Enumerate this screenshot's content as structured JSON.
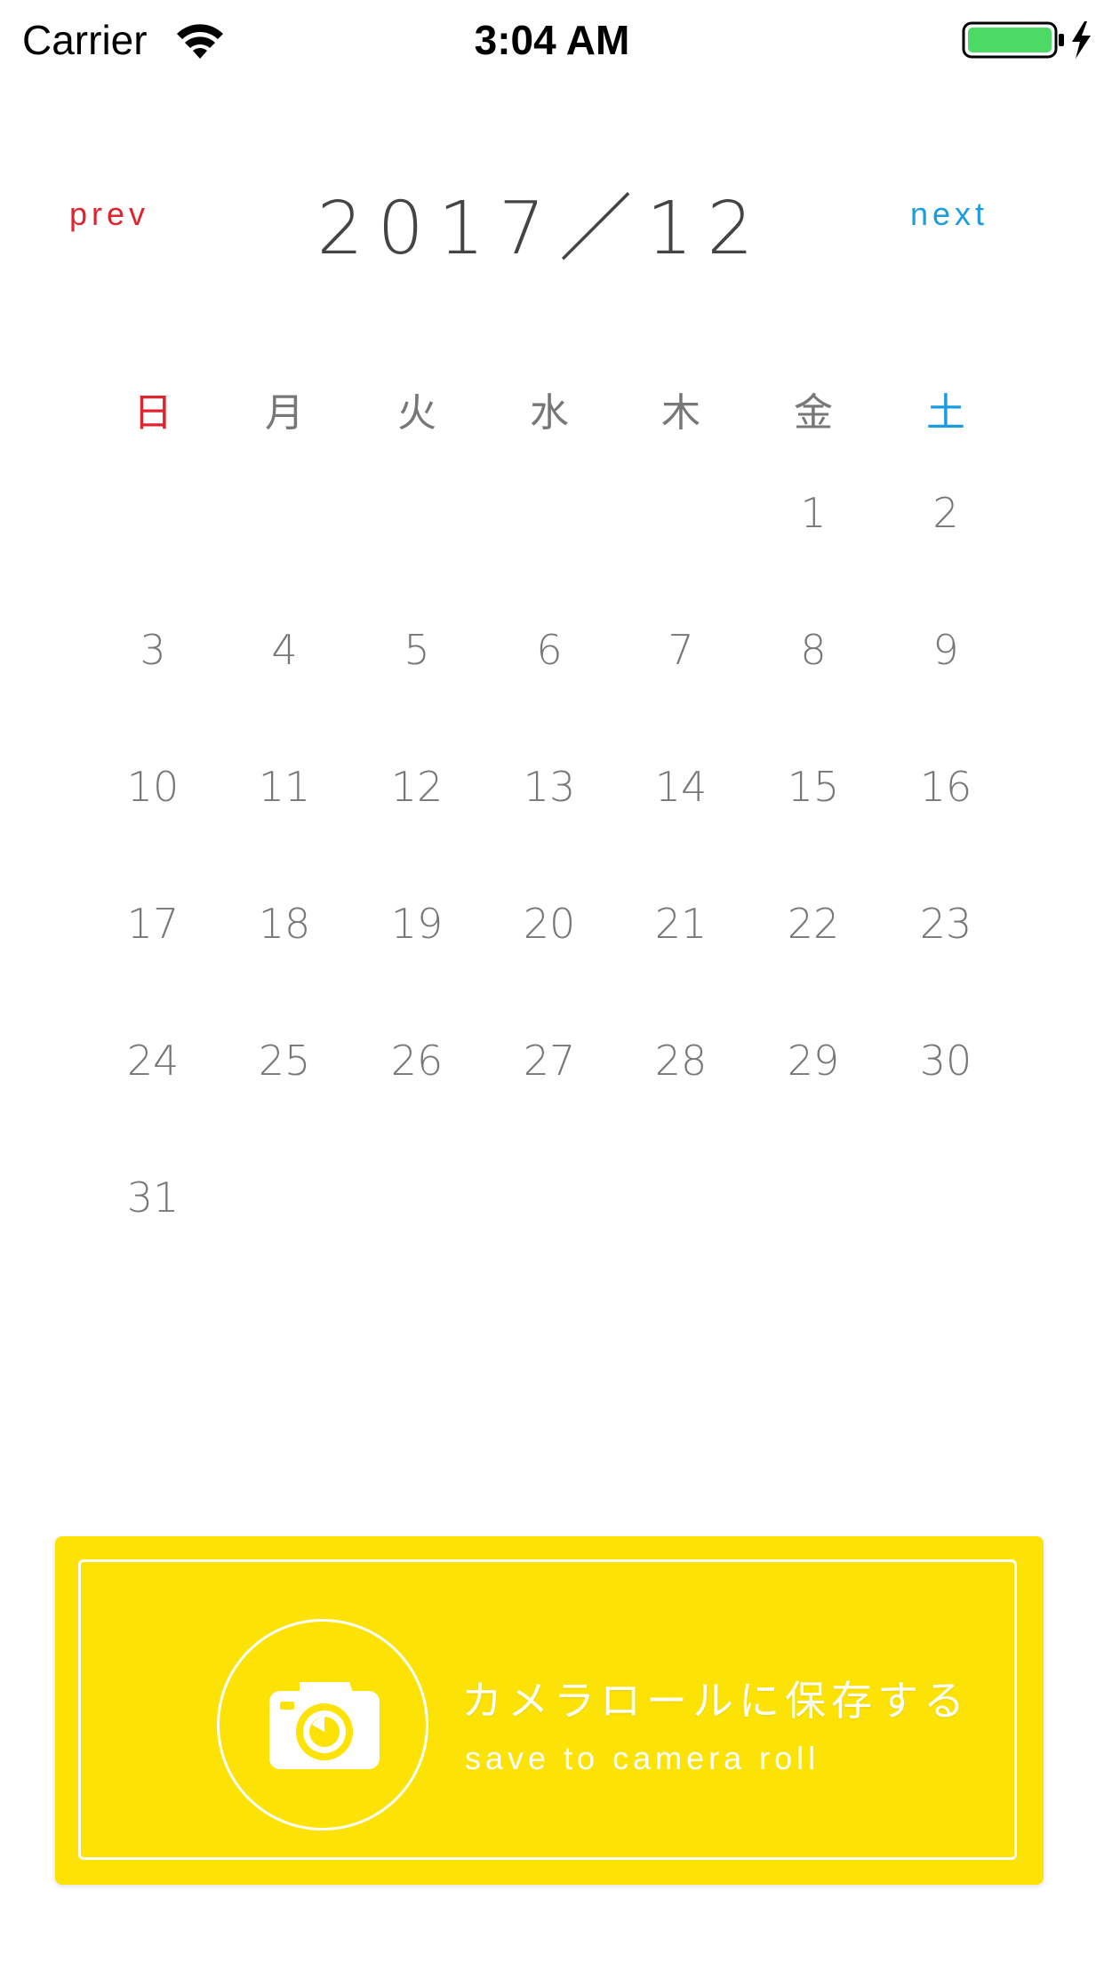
{
  "status_bar": {
    "carrier": "Carrier",
    "time": "3:04 AM",
    "icons": [
      "wifi-icon",
      "battery-icon",
      "charging-bolt-icon"
    ]
  },
  "header": {
    "prev_label": "prev",
    "next_label": "next",
    "month_title": "2017／12"
  },
  "weekdays": [
    "日",
    "月",
    "火",
    "水",
    "木",
    "金",
    "土"
  ],
  "calendar": {
    "leading_blanks": 5,
    "days": [
      "1",
      "2",
      "3",
      "4",
      "5",
      "6",
      "7",
      "8",
      "9",
      "10",
      "11",
      "12",
      "13",
      "14",
      "15",
      "16",
      "17",
      "18",
      "19",
      "20",
      "21",
      "22",
      "23",
      "24",
      "25",
      "26",
      "27",
      "28",
      "29",
      "30",
      "31"
    ]
  },
  "save_button": {
    "label_ja": "カメラロールに保存する",
    "label_en": "save to camera roll",
    "icon": "camera-icon"
  },
  "colors": {
    "sunday": "#e0242f",
    "saturday": "#1a9de0",
    "accent_yellow": "#fde205",
    "text": "#777777",
    "battery_green": "#4cd964"
  }
}
